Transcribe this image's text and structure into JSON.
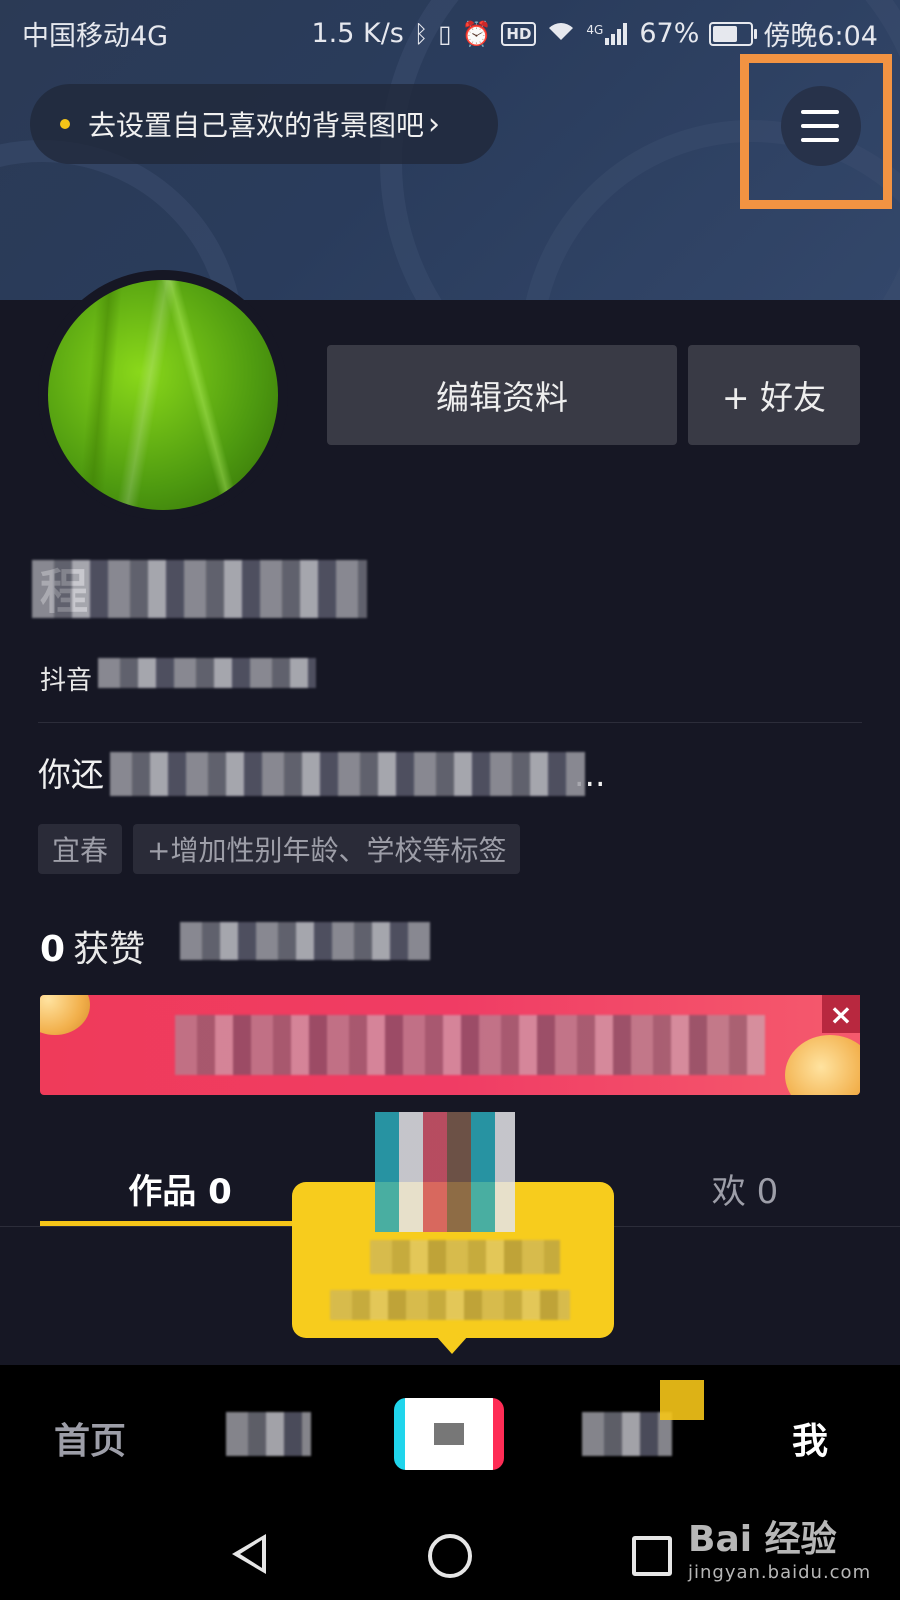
{
  "status_bar": {
    "carrier": "中国移动4G",
    "net_speed": "1.5 K/s",
    "battery": "67%",
    "battery_level": 0.67,
    "time": "傍晚6:04",
    "hd_label": "HD",
    "signal_label": "4G",
    "icons": [
      "bluetooth-icon",
      "vibrate-icon",
      "alarm-icon",
      "hd-icon",
      "wifi-icon",
      "signal-icon",
      "battery-icon"
    ]
  },
  "header": {
    "background_prompt": "去设置自己喜欢的背景图吧",
    "prompt_chevron": "›",
    "menu_icon": "hamburger-menu-icon",
    "highlight_color": "#f29342"
  },
  "profile": {
    "edit_button": "编辑资料",
    "add_friend_button": "+ 好友",
    "name": "程",
    "douyin_id_prefix": "抖音",
    "bio_prefix": "你还",
    "bio_suffix": "...",
    "tags": [
      "宜春",
      "+增加性别年龄、学校等标签"
    ],
    "likes_count": "0",
    "likes_label": "获赞"
  },
  "banner": {
    "close_label": "×",
    "close_icon": "close-icon",
    "color": "#f03c64"
  },
  "tabs": [
    {
      "label": "作品 0",
      "active": true
    },
    {
      "label": "欢 0",
      "active": false
    }
  ],
  "accent_color": "#f5c518",
  "bottom_nav": {
    "home": "首页",
    "me": "我",
    "plus_icon": "create-plus-icon"
  },
  "system_nav": {
    "icons": [
      "back-icon",
      "home-icon",
      "recents-icon"
    ]
  },
  "watermark": {
    "brand": "Bai 经验",
    "url": "jingyan.baidu.com"
  }
}
